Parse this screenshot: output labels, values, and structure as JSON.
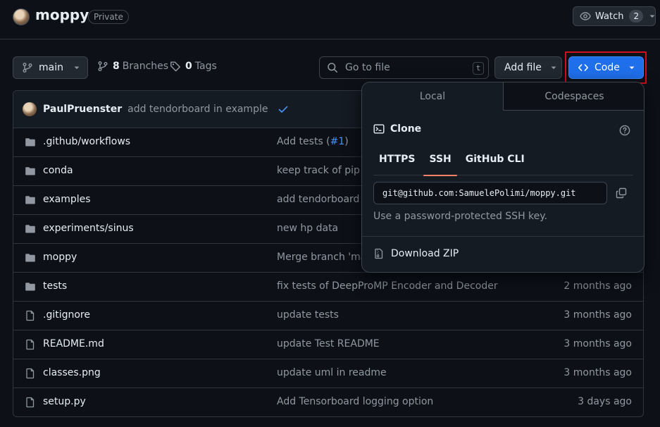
{
  "repo": {
    "name": "moppy",
    "visibility": "Private"
  },
  "watch": {
    "label": "Watch",
    "count": "2"
  },
  "toolbar": {
    "branch": "main",
    "branches_count": "8",
    "branches_label": "Branches",
    "tags_count": "0",
    "tags_label": "Tags",
    "search_placeholder": "Go to file",
    "search_shortcut": "t",
    "add_file_label": "Add file",
    "code_label": "Code"
  },
  "latest_commit": {
    "author": "PaulPruenster",
    "message": "add tendorboard in example"
  },
  "files": [
    {
      "type": "folder",
      "name": ".github/workflows",
      "message": "Add tests (",
      "link": "#1",
      "message_end": ")",
      "time": ""
    },
    {
      "type": "folder",
      "name": "conda",
      "message": "keep track of pip fi",
      "time": ""
    },
    {
      "type": "folder",
      "name": "examples",
      "message": "add tendorboard i",
      "time": ""
    },
    {
      "type": "folder",
      "name": "experiments/sinus",
      "message": "new hp data",
      "time": ""
    },
    {
      "type": "folder",
      "name": "moppy",
      "message": "Merge branch 'ma",
      "time": ""
    },
    {
      "type": "folder",
      "name": "tests",
      "message": "fix tests of DeepProMP Encoder and Decoder",
      "time": "2 months ago"
    },
    {
      "type": "file",
      "name": ".gitignore",
      "message": "update tests",
      "time": "3 months ago"
    },
    {
      "type": "file",
      "name": "README.md",
      "message": "update Test README",
      "time": "3 months ago"
    },
    {
      "type": "file",
      "name": "classes.png",
      "message": "update uml in readme",
      "time": "3 months ago"
    },
    {
      "type": "file",
      "name": "setup.py",
      "message": "Add Tensorboard logging option",
      "time": "3 days ago"
    }
  ],
  "clone_dropdown": {
    "tabs": [
      "Local",
      "Codespaces"
    ],
    "clone_title": "Clone",
    "protocols": [
      "HTTPS",
      "SSH",
      "GitHub CLI"
    ],
    "active_protocol": "SSH",
    "url": "git@github.com:SamuelePolimi/moppy.git",
    "note": "Use a password-protected SSH key.",
    "download_label": "Download ZIP"
  },
  "colors": {
    "accent": "#1f6feb",
    "highlight": "#d0101c",
    "tab_underline": "#f78166",
    "link": "#4493f8"
  }
}
